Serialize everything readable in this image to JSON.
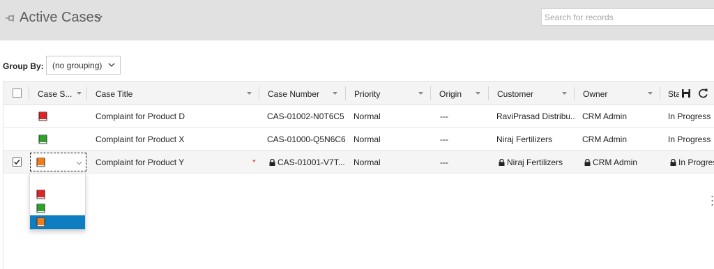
{
  "header": {
    "title": "Active Cases",
    "search_placeholder": "Search for records"
  },
  "groupby": {
    "label": "Group By:",
    "value": "(no grouping)"
  },
  "grid": {
    "columns": [
      "Case S...",
      "Case Title",
      "Case Number",
      "Priority",
      "Origin",
      "Customer",
      "Owner",
      "Sta"
    ],
    "rows": [
      {
        "status_color": "red",
        "title": "Complaint for Product D",
        "number": "CAS-01002-N0T6C5",
        "priority": "Normal",
        "origin": "---",
        "customer": "RaviPrasad Distribu...",
        "owner": "CRM Admin",
        "status": "In Progress",
        "selected": false
      },
      {
        "status_color": "green",
        "title": "Complaint for Product X",
        "number": "CAS-01000-Q5N6C6",
        "priority": "Normal",
        "origin": "---",
        "customer": "Niraj Fertilizers",
        "owner": "CRM Admin",
        "status": "In Progress",
        "selected": false
      },
      {
        "status_color": "orange",
        "title": "Complaint for Product Y",
        "number": "CAS-01001-V7T...",
        "priority": "Normal",
        "origin": "---",
        "customer": "Niraj Fertilizers",
        "owner": "CRM Admin",
        "status": "In Progres",
        "selected": true,
        "required_marker": "*"
      }
    ]
  },
  "status_dropdown": {
    "options": [
      "red",
      "green",
      "orange"
    ],
    "highlighted": "orange"
  },
  "colors": {
    "header_bg": "#e1e1e1",
    "highlight": "#0f7dc2",
    "red_book": "#d9262b",
    "green_book": "#2fa12f",
    "orange_book": "#f07c1a",
    "required": "#d13438"
  },
  "icons": {
    "pin": "pin-icon",
    "view_chevron": "chevron-down-icon",
    "save": "save-icon",
    "refresh": "refresh-icon",
    "lock": "lock-icon",
    "status": "book-icon"
  }
}
